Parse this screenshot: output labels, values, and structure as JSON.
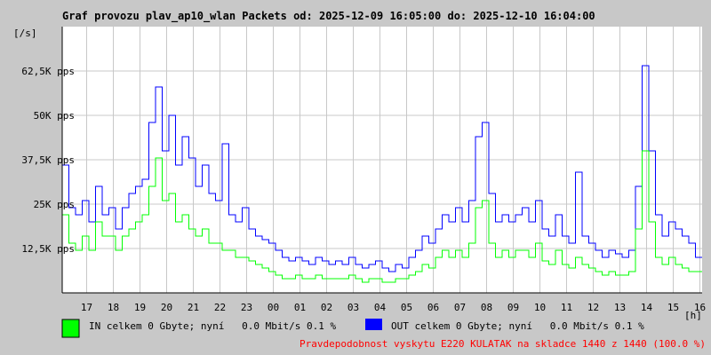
{
  "chart_data": {
    "type": "line",
    "title": "Graf provozu plav_ap10_wlan Packets od: 2025-12-09 16:05:00 do: 2025-12-10 16:04:00",
    "ylabel": "[/s]",
    "xlabel": "[h]",
    "ylim": [
      0,
      75000
    ],
    "yticks": [
      "12,5K pps",
      "25K pps",
      "37,5K pps",
      "50K pps",
      "62,5K pps"
    ],
    "ytick_values": [
      12500,
      25000,
      37500,
      50000,
      62500
    ],
    "xticks": [
      "17",
      "18",
      "19",
      "20",
      "21",
      "22",
      "23",
      "00",
      "01",
      "02",
      "03",
      "04",
      "05",
      "06",
      "07",
      "08",
      "09",
      "10",
      "11",
      "12",
      "13",
      "14",
      "15",
      "16"
    ],
    "x_start": "16:05",
    "x_step_minutes": 15,
    "grid": true,
    "series": [
      {
        "name": "OUT",
        "color": "#0000ff",
        "unit": "K pps",
        "values": [
          36,
          24,
          22,
          26,
          20,
          30,
          22,
          24,
          18,
          24,
          28,
          30,
          32,
          48,
          58,
          40,
          50,
          36,
          44,
          38,
          30,
          36,
          28,
          26,
          42,
          22,
          20,
          24,
          18,
          16,
          15,
          14,
          12,
          10,
          9,
          10,
          9,
          8,
          10,
          9,
          8,
          9,
          8,
          10,
          8,
          7,
          8,
          9,
          7,
          6,
          8,
          7,
          10,
          12,
          16,
          14,
          18,
          22,
          20,
          24,
          20,
          26,
          44,
          48,
          28,
          20,
          22,
          20,
          22,
          24,
          20,
          26,
          18,
          16,
          22,
          16,
          14,
          34,
          16,
          14,
          12,
          10,
          12,
          11,
          10,
          12,
          30,
          64,
          40,
          22,
          16,
          20,
          18,
          16,
          14,
          10
        ]
      },
      {
        "name": "IN",
        "color": "#00ff00",
        "unit": "K pps",
        "values": [
          22,
          14,
          12,
          16,
          12,
          20,
          16,
          16,
          12,
          16,
          18,
          20,
          22,
          30,
          38,
          26,
          28,
          20,
          22,
          18,
          16,
          18,
          14,
          14,
          12,
          12,
          10,
          10,
          9,
          8,
          7,
          6,
          5,
          4,
          4,
          5,
          4,
          4,
          5,
          4,
          4,
          4,
          4,
          5,
          4,
          3,
          4,
          4,
          3,
          3,
          4,
          4,
          5,
          6,
          8,
          7,
          10,
          12,
          10,
          12,
          10,
          14,
          24,
          26,
          14,
          10,
          12,
          10,
          12,
          12,
          10,
          14,
          9,
          8,
          12,
          8,
          7,
          10,
          8,
          7,
          6,
          5,
          6,
          5,
          5,
          6,
          18,
          40,
          20,
          10,
          8,
          10,
          8,
          7,
          6,
          6
        ]
      }
    ]
  },
  "legend": {
    "in": {
      "text": "IN celkem 0 Gbyte; nyní   0.0 Mbit/s 0.1 %",
      "color": "#00ff00"
    },
    "out": {
      "text": "OUT celkem 0 Gbyte; nyní   0.0 Mbit/s 0.1 %",
      "color": "#0000ff"
    }
  },
  "footer": {
    "text": "Pravdepodobnost vyskytu E220 KULATAK na skladce 1440 z 1440 (100.0 %)",
    "color": "#ff0000"
  }
}
